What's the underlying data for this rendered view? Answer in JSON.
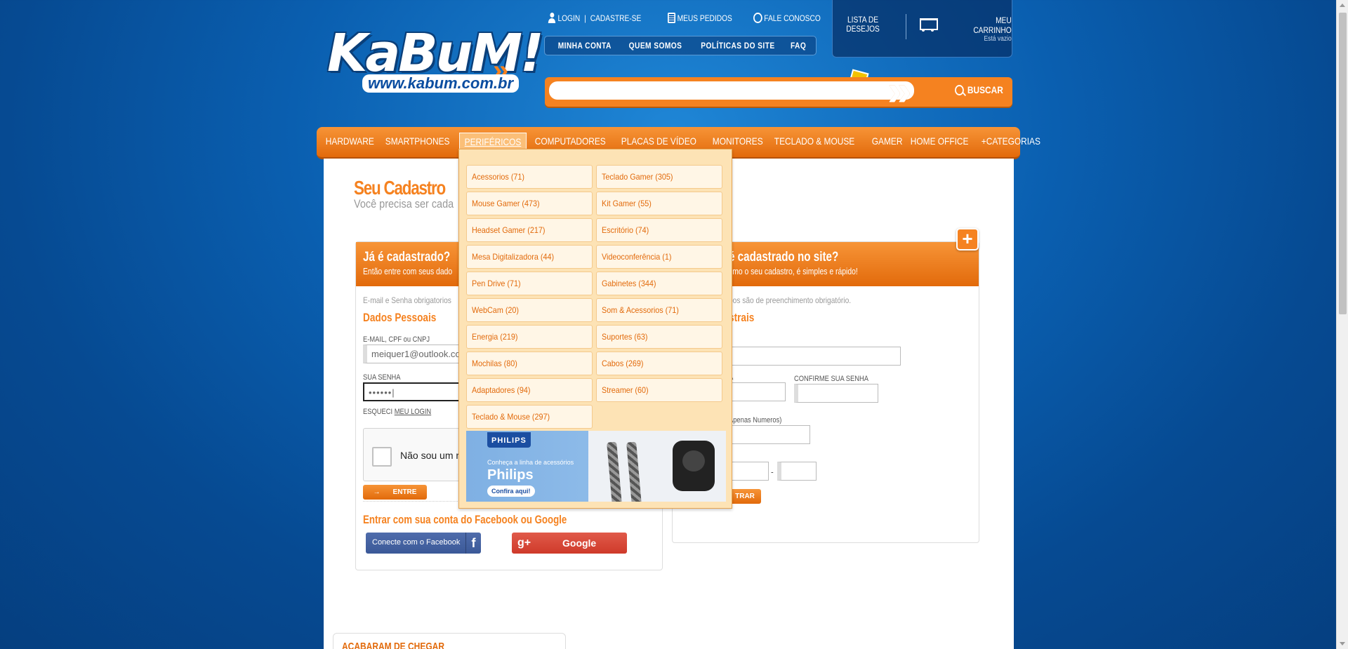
{
  "header": {
    "logo_text": "KaBuM!",
    "logo_url": "www.kabum.com.br",
    "top_links": {
      "login": "LOGIN",
      "separator": "|",
      "signup": "CADASTRE-SE",
      "orders": "MEUS PEDIDOS",
      "contact": "FALE CONOSCO"
    },
    "top_nav": [
      "MINHA CONTA",
      "QUEM SOMOS",
      "POLÍTICAS DO SITE",
      "FAQ"
    ],
    "wishlist": {
      "line1": "LISTA DE",
      "line2": "DESEJOS"
    },
    "cart": {
      "title": "MEU CARRINHO",
      "status": "Está vazio"
    },
    "search": {
      "placeholder": "",
      "button": "BUSCAR"
    }
  },
  "categories": [
    {
      "label": "HARDWARE",
      "active": false
    },
    {
      "label": "SMARTPHONES",
      "active": false
    },
    {
      "label": "PERIFÉRICOS",
      "active": true
    },
    {
      "label": "COMPUTADORES",
      "active": false
    },
    {
      "label": "PLACAS DE VÍDEO",
      "active": false
    },
    {
      "label": "MONITORES",
      "active": false
    },
    {
      "label": "TECLADO & MOUSE",
      "active": false
    },
    {
      "label": "GAMER",
      "active": false
    },
    {
      "label": "HOME OFFICE",
      "active": false
    },
    {
      "label": "+CATEGORIAS",
      "active": false
    }
  ],
  "dropdown": {
    "items": [
      "Acessorios (71)",
      "Teclado Gamer (305)",
      "Mouse Gamer (473)",
      "Kit Gamer (55)",
      "Headset Gamer (217)",
      "Escritório (74)",
      "Mesa Digitalizadora (44)",
      "Videoconferência (1)",
      "Pen Drive (71)",
      "Gabinetes (344)",
      "WebCam (20)",
      "Som & Acessorios (71)",
      "Energia (219)",
      "Suportes (63)",
      "Mochilas (80)",
      "Cabos (269)",
      "Adaptadores (94)",
      "Streamer (60)",
      "Teclado & Mouse (297)"
    ],
    "banner": {
      "brand": "PHILIPS",
      "line1": "Conheça a linha de acessórios",
      "line2": "Philips",
      "cta": "Confira aqui!"
    }
  },
  "page": {
    "title": "Seu Cadastro",
    "subtitle": "Você precisa ser cada"
  },
  "login_panel": {
    "title": "Já é cadastrado?",
    "subtitle": "Então entre com seus dado",
    "note": "E-mail e Senha obrigatorios",
    "section": "Dados Pessoais",
    "email_label": "E-MAIL, CPF ou CNPJ",
    "email_value": "meiquer1@outlook.com",
    "password_label": "SUA SENHA",
    "password_value": "••••••|",
    "forgot_prefix": "ESQUECI",
    "forgot_link": "MEU LOGIN",
    "captcha_text": "Não sou um r",
    "enter_button": "ENTRE",
    "social_title": "Entrar com sua conta do Facebook ou Google",
    "facebook_button": "Conecte com o Facebook",
    "google_button": "Google"
  },
  "register_panel": {
    "title": "é cadastrado no site?",
    "subtitle": "smo o seu cadastro, é simples e rápido!",
    "note": "pos são de preenchimento obrigatório.",
    "section": "strais",
    "password_label_partial": "A",
    "confirm_label": "CONFIRME SUA SENHA",
    "phone_label_partial": "Apenas Numeros)",
    "dash": "-",
    "register_button": "TRAR"
  },
  "bottom": {
    "section_title": "ACABARAM DE CHEGAR"
  },
  "colors": {
    "brand_orange": "#f58220",
    "brand_blue": "#0a5fb0"
  }
}
